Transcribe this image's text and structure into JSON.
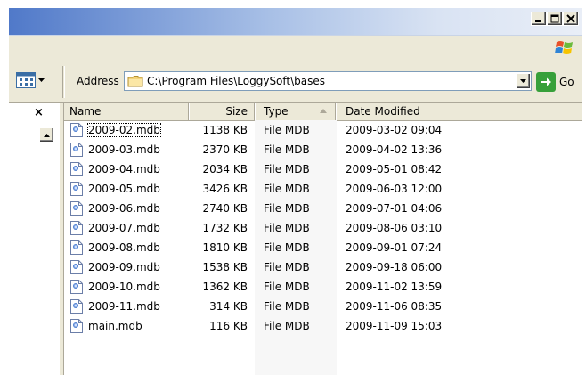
{
  "window": {
    "caption_buttons": [
      {
        "name": "minimize",
        "icon": "minimize-icon"
      },
      {
        "name": "maximize",
        "icon": "maximize-icon"
      },
      {
        "name": "close",
        "icon": "close-icon"
      }
    ]
  },
  "toolbar": {
    "address_label": "Address",
    "address_path": "C:\\Program Files\\LoggySoft\\bases",
    "go_label": "Go"
  },
  "left_pane": {
    "close_glyph": "×"
  },
  "list": {
    "columns": {
      "name": "Name",
      "size": "Size",
      "type": "Type",
      "date": "Date Modified"
    },
    "sorted_by": "Type",
    "files": [
      {
        "name": "2009-02.mdb",
        "size": "1138 KB",
        "type": "File MDB",
        "date": "2009-03-02 09:04"
      },
      {
        "name": "2009-03.mdb",
        "size": "2370 KB",
        "type": "File MDB",
        "date": "2009-04-02 13:36"
      },
      {
        "name": "2009-04.mdb",
        "size": "2034 KB",
        "type": "File MDB",
        "date": "2009-05-01 08:42"
      },
      {
        "name": "2009-05.mdb",
        "size": "3426 KB",
        "type": "File MDB",
        "date": "2009-06-03 12:00"
      },
      {
        "name": "2009-06.mdb",
        "size": "2740 KB",
        "type": "File MDB",
        "date": "2009-07-01 04:06"
      },
      {
        "name": "2009-07.mdb",
        "size": "1732 KB",
        "type": "File MDB",
        "date": "2009-08-06 03:10"
      },
      {
        "name": "2009-08.mdb",
        "size": "1810 KB",
        "type": "File MDB",
        "date": "2009-09-01 07:24"
      },
      {
        "name": "2009-09.mdb",
        "size": "1538 KB",
        "type": "File MDB",
        "date": "2009-09-18 06:00"
      },
      {
        "name": "2009-10.mdb",
        "size": "1362 KB",
        "type": "File MDB",
        "date": "2009-11-02 13:59"
      },
      {
        "name": "2009-11.mdb",
        "size": "314 KB",
        "type": "File MDB",
        "date": "2009-11-06 08:35"
      },
      {
        "name": "main.mdb",
        "size": "116 KB",
        "type": "File MDB",
        "date": "2009-11-09 15:03"
      }
    ]
  },
  "colors": {
    "chrome": "#ece9d8",
    "title_gradient_start": "#5079c9",
    "go_green": "#37a03a",
    "folder_yellow": "#f3d37a"
  }
}
